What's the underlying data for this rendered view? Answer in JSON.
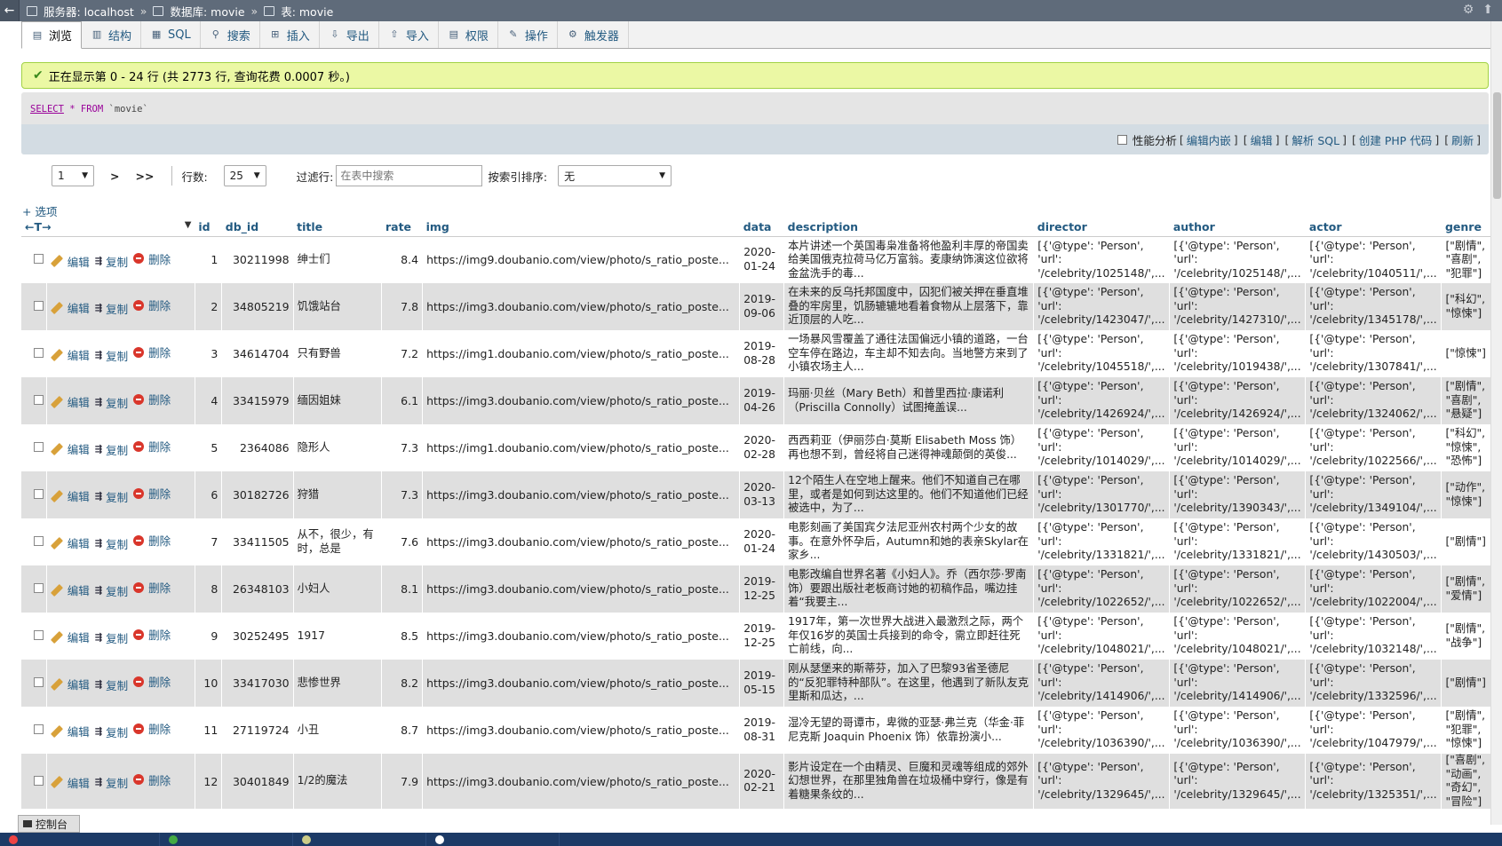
{
  "breadcrumb": {
    "server_label": "服务器: localhost",
    "database_label": "数据库: movie",
    "table_label": "表: movie",
    "sep": "»"
  },
  "tabs": [
    {
      "label": "浏览",
      "icon": "browse-icon"
    },
    {
      "label": "结构",
      "icon": "structure-icon"
    },
    {
      "label": "SQL",
      "icon": "sql-icon"
    },
    {
      "label": "搜索",
      "icon": "search-icon"
    },
    {
      "label": "插入",
      "icon": "insert-icon"
    },
    {
      "label": "导出",
      "icon": "export-icon"
    },
    {
      "label": "导入",
      "icon": "import-icon"
    },
    {
      "label": "权限",
      "icon": "privileges-icon"
    },
    {
      "label": "操作",
      "icon": "operations-icon"
    },
    {
      "label": "触发器",
      "icon": "triggers-icon"
    }
  ],
  "message": "正在显示第 0 - 24 行 (共 2773 行, 查询花费 0.0007 秒。)",
  "sql": {
    "select": "SELECT",
    "star_from": " * FROM ",
    "table": "`movie`"
  },
  "sqlbar": {
    "profiling": "性能分析",
    "inline_edit": "编辑内嵌",
    "edit": "编辑",
    "explain": "解析 SQL",
    "php": "创建 PHP 代码",
    "refresh": "刷新"
  },
  "nav": {
    "page": "1",
    "next": ">",
    "last": ">>",
    "rows_label": "行数:",
    "rows": "25",
    "filter_label": "过滤行:",
    "filter_placeholder": "在表中搜索",
    "sort_label": "按索引排序:",
    "sort_value": "无"
  },
  "options_link": "+ 选项",
  "columns": [
    "id",
    "db_id",
    "title",
    "rate",
    "img",
    "data",
    "description",
    "director",
    "author",
    "actor",
    "genre"
  ],
  "actions": {
    "edit": "编辑",
    "copy": "复制",
    "delete": "删除"
  },
  "rows": [
    {
      "id": "1",
      "db_id": "30211998",
      "title": "绅士们",
      "rate": "8.4",
      "img": "https://img9.doubanio.com/view/photo/s_ratio_poste...",
      "date": "2020-01-24",
      "description": "本片讲述一个英国毒枭准备将他盈利丰厚的帝国卖给美国俄克拉荷马亿万富翁。麦康纳饰演这位欲将金盆洗手的毒...",
      "director": "[{'@type': 'Person', 'url': '/celebrity/1025148/',...",
      "author": "[{'@type': 'Person', 'url': '/celebrity/1025148/',...",
      "actor": "[{'@type': 'Person', 'url': '/celebrity/1040511/',...",
      "genre": "[\"剧情\", \"喜剧\", \"犯罪\"]"
    },
    {
      "id": "2",
      "db_id": "34805219",
      "title": "饥饿站台",
      "rate": "7.8",
      "img": "https://img3.doubanio.com/view/photo/s_ratio_poste...",
      "date": "2019-09-06",
      "description": "在未来的反乌托邦国度中，囚犯们被关押在垂直堆叠的牢房里，饥肠辘辘地看着食物从上层落下，靠近顶层的人吃...",
      "director": "[{'@type': 'Person', 'url': '/celebrity/1423047/',...",
      "author": "[{'@type': 'Person', 'url': '/celebrity/1427310/',...",
      "actor": "[{'@type': 'Person', 'url': '/celebrity/1345178/',...",
      "genre": "[\"科幻\", \"惊悚\"]"
    },
    {
      "id": "3",
      "db_id": "34614704",
      "title": "只有野兽",
      "rate": "7.2",
      "img": "https://img1.doubanio.com/view/photo/s_ratio_poste...",
      "date": "2019-08-28",
      "description": "一场暴风雪覆盖了通往法国偏远小镇的道路，一台空车停在路边，车主却不知去向。当地警方来到了小镇农场主人...",
      "director": "[{'@type': 'Person', 'url': '/celebrity/1045518/',...",
      "author": "[{'@type': 'Person', 'url': '/celebrity/1019438/',...",
      "actor": "[{'@type': 'Person', 'url': '/celebrity/1307841/',...",
      "genre": "[\"惊悚\"]"
    },
    {
      "id": "4",
      "db_id": "33415979",
      "title": "缅因姐妹",
      "rate": "6.1",
      "img": "https://img3.doubanio.com/view/photo/s_ratio_poste...",
      "date": "2019-04-26",
      "description": "玛丽·贝丝（Mary Beth）和普里西拉·康诺利（Priscilla Connolly）试图掩盖误...",
      "director": "[{'@type': 'Person', 'url': '/celebrity/1426924/',...",
      "author": "[{'@type': 'Person', 'url': '/celebrity/1426924/',...",
      "actor": "[{'@type': 'Person', 'url': '/celebrity/1324062/',...",
      "genre": "[\"剧情\", \"喜剧\", \"悬疑\"]"
    },
    {
      "id": "5",
      "db_id": "2364086",
      "title": "隐形人",
      "rate": "7.3",
      "img": "https://img1.doubanio.com/view/photo/s_ratio_poste...",
      "date": "2020-02-28",
      "description": "西西莉亚（伊丽莎白·莫斯 Elisabeth Moss 饰）再也想不到，曾经将自己迷得神魂颠倒的英俊...",
      "director": "[{'@type': 'Person', 'url': '/celebrity/1014029/',...",
      "author": "[{'@type': 'Person', 'url': '/celebrity/1014029/',...",
      "actor": "[{'@type': 'Person', 'url': '/celebrity/1022566/',...",
      "genre": "[\"科幻\", \"惊悚\", \"恐怖\"]"
    },
    {
      "id": "6",
      "db_id": "30182726",
      "title": "狩猎",
      "rate": "7.3",
      "img": "https://img3.doubanio.com/view/photo/s_ratio_poste...",
      "date": "2020-03-13",
      "description": "12个陌生人在空地上醒来。他们不知道自己在哪里，或者是如何到达这里的。他们不知道他们已经被选中，为了...",
      "director": "[{'@type': 'Person', 'url': '/celebrity/1301770/',...",
      "author": "[{'@type': 'Person', 'url': '/celebrity/1390343/',...",
      "actor": "[{'@type': 'Person', 'url': '/celebrity/1349104/',...",
      "genre": "[\"动作\", \"惊悚\"]"
    },
    {
      "id": "7",
      "db_id": "33411505",
      "title": "从不，很少，有时，总是",
      "rate": "7.6",
      "img": "https://img3.doubanio.com/view/photo/s_ratio_poste...",
      "date": "2020-01-24",
      "description": "电影刻画了美国宾夕法尼亚州农村两个少女的故事。在意外怀孕后，Autumn和她的表亲Skylar在家乡...",
      "director": "[{'@type': 'Person', 'url': '/celebrity/1331821/',...",
      "author": "[{'@type': 'Person', 'url': '/celebrity/1331821/',...",
      "actor": "[{'@type': 'Person', 'url': '/celebrity/1430503/',...",
      "genre": "[\"剧情\"]"
    },
    {
      "id": "8",
      "db_id": "26348103",
      "title": "小妇人",
      "rate": "8.1",
      "img": "https://img3.doubanio.com/view/photo/s_ratio_poste...",
      "date": "2019-12-25",
      "description": "电影改编自世界名著《小妇人》。乔（西尔莎·罗南 饰）要跟出版社老板商讨她的初稿作品，嘴边挂着“我要主...",
      "director": "[{'@type': 'Person', 'url': '/celebrity/1022652/',...",
      "author": "[{'@type': 'Person', 'url': '/celebrity/1022652/',...",
      "actor": "[{'@type': 'Person', 'url': '/celebrity/1022004/',...",
      "genre": "[\"剧情\", \"爱情\"]"
    },
    {
      "id": "9",
      "db_id": "30252495",
      "title": "1917",
      "rate": "8.5",
      "img": "https://img3.doubanio.com/view/photo/s_ratio_poste...",
      "date": "2019-12-25",
      "description": "1917年，第一次世界大战进入最激烈之际，两个年仅16岁的英国士兵接到的命令，需立即赶往死亡前线，向...",
      "director": "[{'@type': 'Person', 'url': '/celebrity/1048021/',...",
      "author": "[{'@type': 'Person', 'url': '/celebrity/1048021/',...",
      "actor": "[{'@type': 'Person', 'url': '/celebrity/1032148/',...",
      "genre": "[\"剧情\", \"战争\"]"
    },
    {
      "id": "10",
      "db_id": "33417030",
      "title": "悲惨世界",
      "rate": "8.2",
      "img": "https://img3.doubanio.com/view/photo/s_ratio_poste...",
      "date": "2019-05-15",
      "description": "刚从瑟堡来的斯蒂芬，加入了巴黎93省圣德尼的“反犯罪特种部队”。在这里，他遇到了新队友克里斯和瓜达，...",
      "director": "[{'@type': 'Person', 'url': '/celebrity/1414906/',...",
      "author": "[{'@type': 'Person', 'url': '/celebrity/1414906/',...",
      "actor": "[{'@type': 'Person', 'url': '/celebrity/1332596/',...",
      "genre": "[\"剧情\"]"
    },
    {
      "id": "11",
      "db_id": "27119724",
      "title": "小丑",
      "rate": "8.7",
      "img": "https://img3.doubanio.com/view/photo/s_ratio_poste...",
      "date": "2019-08-31",
      "description": "湿冷无望的哥谭市，卑微的亚瑟·弗兰克（华金·菲尼克斯 Joaquin Phoenix 饰）依靠扮演小...",
      "director": "[{'@type': 'Person', 'url': '/celebrity/1036390/',...",
      "author": "[{'@type': 'Person', 'url': '/celebrity/1036390/',...",
      "actor": "[{'@type': 'Person', 'url': '/celebrity/1047979/',...",
      "genre": "[\"剧情\", \"犯罪\", \"惊悚\"]"
    },
    {
      "id": "12",
      "db_id": "30401849",
      "title": "1/2的魔法",
      "rate": "7.9",
      "img": "https://img3.doubanio.com/view/photo/s_ratio_poste...",
      "date": "2020-02-21",
      "description": "影片设定在一个由精灵、巨魔和灵魂等组成的郊外幻想世界，在那里独角兽在垃圾桶中穿行，像是有着糖果条纹的...",
      "director": "[{'@type': 'Person', 'url': '/celebrity/1329645/',...",
      "author": "[{'@type': 'Person', 'url': '/celebrity/1329645/',...",
      "actor": "[{'@type': 'Person', 'url': '/celebrity/1325351/',...",
      "genre": "[\"喜剧\", \"动画\", \"奇幻\", \"冒险\"]"
    }
  ],
  "console_label": "控制台",
  "colors": {
    "link": "#235a81",
    "success_bg": "#ebf8a4",
    "row_alt": "#dfdfdf"
  }
}
